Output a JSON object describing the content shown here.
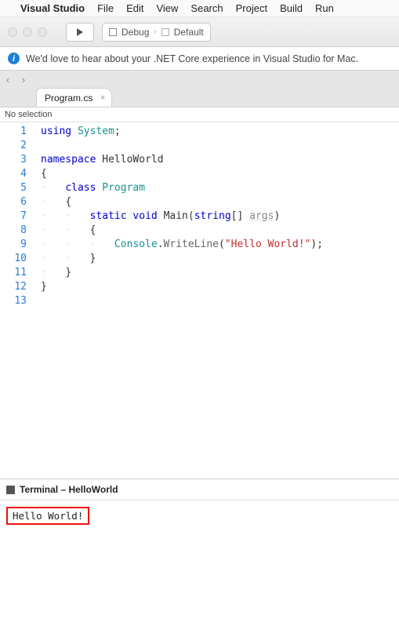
{
  "menubar": {
    "apple": "",
    "app": "Visual Studio",
    "items": [
      "File",
      "Edit",
      "View",
      "Search",
      "Project",
      "Build",
      "Run"
    ]
  },
  "toolbar": {
    "config_left": "Debug",
    "config_right": "Default"
  },
  "info_bar": {
    "text": "We'd love to hear about your .NET Core experience in Visual Studio for Mac."
  },
  "tabs": {
    "active": "Program.cs"
  },
  "breadcrumb": {
    "no_selection": "No selection"
  },
  "code": {
    "lines": [
      "1",
      "2",
      "3",
      "4",
      "5",
      "6",
      "7",
      "8",
      "9",
      "10",
      "11",
      "12",
      "13"
    ],
    "tokens": {
      "using": "using",
      "system": "System",
      "namespace": "namespace",
      "ns_name": "HelloWorld",
      "class": "class",
      "class_name": "Program",
      "static": "static",
      "void": "void",
      "main": "Main",
      "string": "string",
      "args": "args",
      "console": "Console",
      "writeline": "WriteLine",
      "hello_str": "\"Hello World!\""
    }
  },
  "terminal": {
    "title": "Terminal – HelloWorld",
    "output": "Hello World!"
  }
}
